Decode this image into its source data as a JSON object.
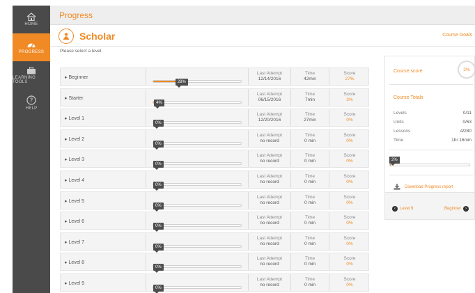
{
  "sidebar": {
    "items": [
      {
        "label": "HOME",
        "icon": "home-icon",
        "active": false
      },
      {
        "label": "PROGRESS",
        "icon": "dashboard-icon",
        "active": true
      },
      {
        "label": "LEARNING TOOLS",
        "icon": "briefcase-icon",
        "active": false
      },
      {
        "label": "HELP",
        "icon": "help-icon",
        "active": false
      }
    ]
  },
  "header": {
    "title": "Progress"
  },
  "product": {
    "name": "Scholar",
    "course_goals": "Course Goals"
  },
  "instruction": "Please select a level.",
  "columns": {
    "last_attempt": "Last Attempt",
    "time": "Time",
    "score": "Score"
  },
  "levels": [
    {
      "name": "Beginner",
      "percent_label": "28%",
      "progress": 28,
      "last_attempt": "12/14/2016",
      "time": "42min",
      "score": "27%"
    },
    {
      "name": "Starter",
      "percent_label": "4%",
      "progress": 4,
      "last_attempt": "06/15/2016",
      "time": "7min",
      "score": "3%"
    },
    {
      "name": "Level 1",
      "percent_label": "0%",
      "progress": 0,
      "last_attempt": "12/20/2016",
      "time": "27min",
      "score": "0%"
    },
    {
      "name": "Level 2",
      "percent_label": "0%",
      "progress": 0,
      "last_attempt": "no record",
      "time": "0 min",
      "score": "0%"
    },
    {
      "name": "Level 3",
      "percent_label": "0%",
      "progress": 0,
      "last_attempt": "no record",
      "time": "0 min",
      "score": "0%"
    },
    {
      "name": "Level 4",
      "percent_label": "0%",
      "progress": 0,
      "last_attempt": "no record",
      "time": "0 min",
      "score": "0%"
    },
    {
      "name": "Level 5",
      "percent_label": "0%",
      "progress": 0,
      "last_attempt": "no record",
      "time": "0 min",
      "score": "0%"
    },
    {
      "name": "Level 6",
      "percent_label": "0%",
      "progress": 0,
      "last_attempt": "no record",
      "time": "0 min",
      "score": "0%"
    },
    {
      "name": "Level 7",
      "percent_label": "0%",
      "progress": 0,
      "last_attempt": "no record",
      "time": "0 min",
      "score": "0%"
    },
    {
      "name": "Level 8",
      "percent_label": "0%",
      "progress": 0,
      "last_attempt": "no record",
      "time": "0 min",
      "score": "0%"
    },
    {
      "name": "Level 9",
      "percent_label": "0%",
      "progress": 0,
      "last_attempt": "no record",
      "time": "0 min",
      "score": "0%"
    }
  ],
  "course_panel": {
    "score_label": "Course score",
    "score_value": "2%",
    "totals_label": "Course Totals",
    "totals": [
      {
        "label": "Levels",
        "value": "0/11"
      },
      {
        "label": "Units",
        "value": "0/63"
      },
      {
        "label": "Lessons",
        "value": "4/280"
      },
      {
        "label": "Time",
        "value": "1hr 16min"
      }
    ],
    "progress_label": "2%",
    "progress": 2,
    "download_label": "Download Progress report",
    "prev_label": "Level 9",
    "next_label": "Beginner"
  },
  "colors": {
    "accent": "#f08a24",
    "sidebar": "#4a4a4a",
    "bubble": "#4d4d4d"
  }
}
